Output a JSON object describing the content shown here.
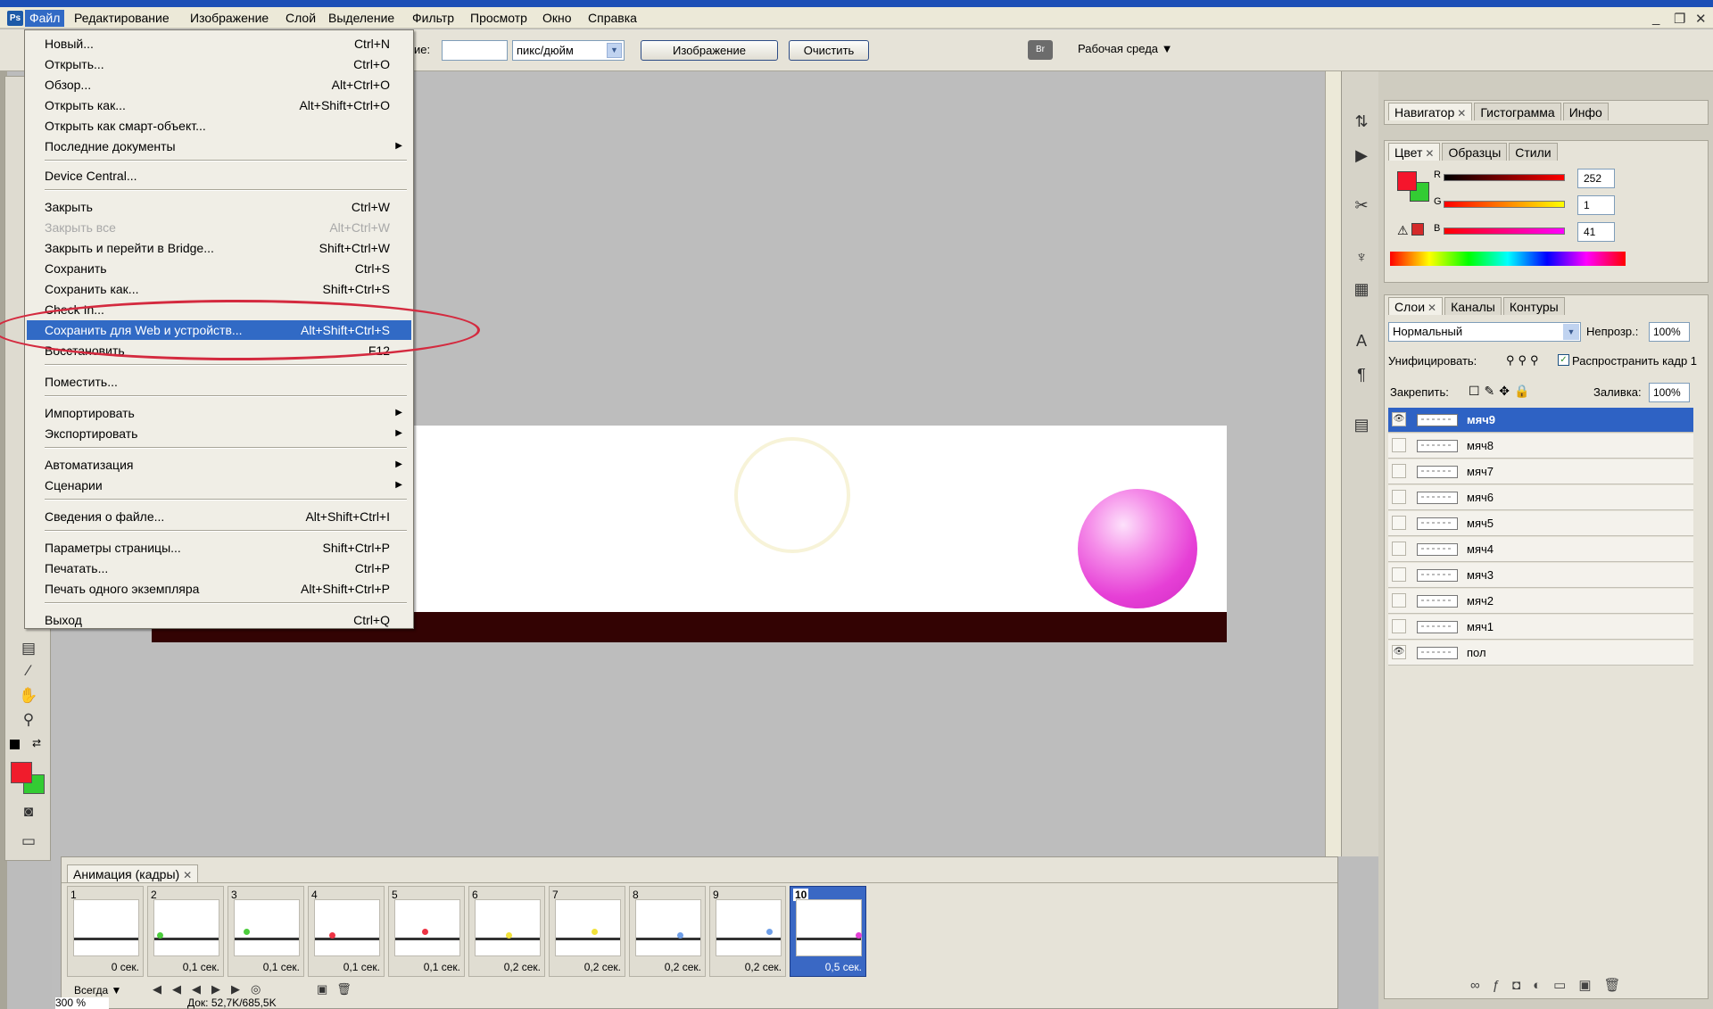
{
  "menubar": {
    "logo": "Ps",
    "items": [
      "Файл",
      "Редактирование",
      "Изображение",
      "Слой",
      "Выделение",
      "Фильтр",
      "Просмотр",
      "Окно",
      "Справка"
    ],
    "active_index": 0,
    "min": "_",
    "restore": "❐",
    "close": "✕"
  },
  "options": {
    "resolution_label": "ие:",
    "resolution_value": "",
    "unit": "пикс/дюйм",
    "image_button": "Изображение",
    "clear_button": "Очистить",
    "workspace": "Рабочая среда"
  },
  "file_menu": {
    "items": [
      {
        "label": "Новый...",
        "shortcut": "Ctrl+N"
      },
      {
        "label": "Открыть...",
        "shortcut": "Ctrl+O"
      },
      {
        "label": "Обзор...",
        "shortcut": "Alt+Ctrl+O"
      },
      {
        "label": "Открыть как...",
        "shortcut": "Alt+Shift+Ctrl+O"
      },
      {
        "label": "Открыть как смарт-объект...",
        "shortcut": ""
      },
      {
        "label": "Последние документы",
        "shortcut": ""
      },
      {
        "label": "Device Central...",
        "shortcut": ""
      },
      {
        "label": "Закрыть",
        "shortcut": "Ctrl+W"
      },
      {
        "label": "Закрыть все",
        "shortcut": "Alt+Ctrl+W"
      },
      {
        "label": "Закрыть и перейти в Bridge...",
        "shortcut": "Shift+Ctrl+W"
      },
      {
        "label": "Сохранить",
        "shortcut": "Ctrl+S"
      },
      {
        "label": "Сохранить как...",
        "shortcut": "Shift+Ctrl+S"
      },
      {
        "label": "Check In...",
        "shortcut": ""
      },
      {
        "label": "Сохранить для Web и устройств...",
        "shortcut": "Alt+Shift+Ctrl+S"
      },
      {
        "label": "Восстановить",
        "shortcut": "F12"
      },
      {
        "label": "Поместить...",
        "shortcut": ""
      },
      {
        "label": "Импортировать",
        "shortcut": ""
      },
      {
        "label": "Экспортировать",
        "shortcut": ""
      },
      {
        "label": "Автоматизация",
        "shortcut": ""
      },
      {
        "label": "Сценарии",
        "shortcut": ""
      },
      {
        "label": "Сведения о файле...",
        "shortcut": "Alt+Shift+Ctrl+I"
      },
      {
        "label": "Параметры страницы...",
        "shortcut": "Shift+Ctrl+P"
      },
      {
        "label": "Печатать...",
        "shortcut": "Ctrl+P"
      },
      {
        "label": "Печать одного экземпляра",
        "shortcut": "Alt+Shift+Ctrl+P"
      },
      {
        "label": "Выход",
        "shortcut": "Ctrl+Q"
      }
    ],
    "highlighted_index": 13,
    "disabled_index": 8
  },
  "navigator_panel": {
    "tabs": [
      "Навигатор",
      "Гистограмма",
      "Инфо"
    ]
  },
  "color_panel": {
    "tabs": [
      "Цвет",
      "Образцы",
      "Стили"
    ],
    "r_label": "R",
    "g_label": "G",
    "b_label": "B",
    "r": "252",
    "g": "1",
    "b": "41",
    "foreground": "#f5152c",
    "background": "#33cc33"
  },
  "layers_panel": {
    "tabs": [
      "Слои",
      "Каналы",
      "Контуры"
    ],
    "blend_mode": "Нормальный",
    "opacity_label": "Непрозр.:",
    "opacity": "100%",
    "unify_label": "Унифицировать:",
    "propagate_label": "Распространить кадр 1",
    "lock_label": "Закрепить:",
    "fill_label": "Заливка:",
    "fill": "100%",
    "layers": [
      {
        "name": "мяч9",
        "visible": true,
        "selected": true
      },
      {
        "name": "мяч8",
        "visible": false
      },
      {
        "name": "мяч7",
        "visible": false
      },
      {
        "name": "мяч6",
        "visible": false
      },
      {
        "name": "мяч5",
        "visible": false
      },
      {
        "name": "мяч4",
        "visible": false
      },
      {
        "name": "мяч3",
        "visible": false
      },
      {
        "name": "мяч2",
        "visible": false
      },
      {
        "name": "мяч1",
        "visible": false
      },
      {
        "name": "пол",
        "visible": true
      }
    ]
  },
  "animation_panel": {
    "tab": "Анимация (кадры)",
    "frames": [
      {
        "num": "1",
        "delay": "0 сек.",
        "dot": ""
      },
      {
        "num": "2",
        "delay": "0,1 сек.",
        "dot": "#4ccd3c"
      },
      {
        "num": "3",
        "delay": "0,1 сек.",
        "dot": "#4ccd3c"
      },
      {
        "num": "4",
        "delay": "0,1 сек.",
        "dot": "#ee3344"
      },
      {
        "num": "5",
        "delay": "0,1 сек.",
        "dot": "#ee3344"
      },
      {
        "num": "6",
        "delay": "0,2 сек.",
        "dot": "#f2e23a"
      },
      {
        "num": "7",
        "delay": "0,2 сек.",
        "dot": "#f2e23a"
      },
      {
        "num": "8",
        "delay": "0,2 сек.",
        "dot": "#6f9fe8"
      },
      {
        "num": "9",
        "delay": "0,2 сек.",
        "dot": "#6f9fe8"
      },
      {
        "num": "10",
        "delay": "0,5 сек.",
        "dot": "#e540d6"
      }
    ],
    "selected_frame": 10,
    "loop": "Всегда"
  },
  "status": {
    "zoom": "300 %",
    "doc": "Док: 52,7K/685,5K"
  }
}
